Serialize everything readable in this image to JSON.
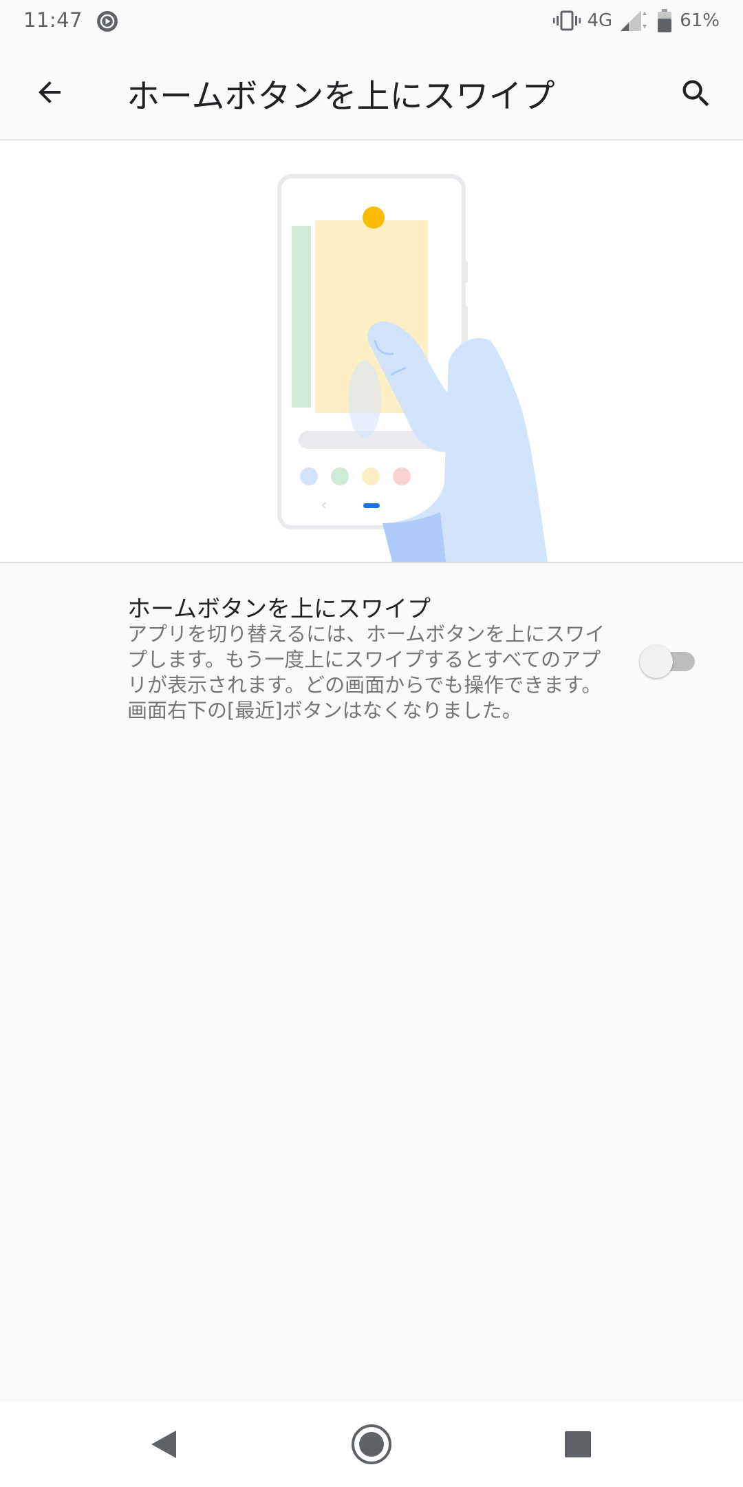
{
  "status_bar": {
    "time": "11:47",
    "network": "4G",
    "battery": "61%",
    "icons": [
      "media-play-icon",
      "vibrate-icon",
      "signal-icon",
      "battery-icon"
    ]
  },
  "app_bar": {
    "title": "ホームボタンを上にスワイプ",
    "back_icon": "arrow-back-icon",
    "search_icon": "search-icon"
  },
  "setting": {
    "title": "ホームボタンを上にスワイプ",
    "summary": "アプリを切り替えるには、ホームボタンを上にスワイプします。もう一度上にスワイプするとすべてのアプリが表示されます。どの画面からでも操作できます。画面右下の[最近]ボタンはなくなりました。",
    "enabled": false
  },
  "nav_bar": {
    "icons": [
      "nav-back-icon",
      "nav-home-icon",
      "nav-recents-icon"
    ]
  },
  "colors": {
    "background": "#fafafa",
    "accent_blue": "#1a73e8",
    "hand_blue": "#d2e3fc",
    "card_yellow": "#fdefc3",
    "dot_yellow": "#fbbc04",
    "card_green": "#ceead6"
  }
}
